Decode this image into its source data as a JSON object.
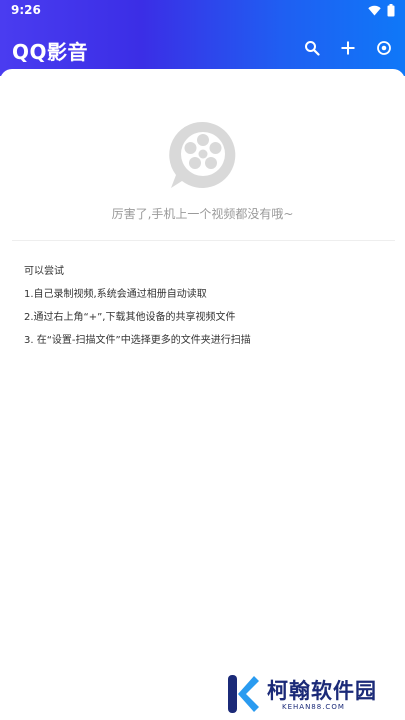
{
  "status_bar": {
    "time": "9:26",
    "icons": [
      "wifi-icon",
      "battery-icon"
    ]
  },
  "header": {
    "title": "QQ影音",
    "actions": [
      {
        "name": "search",
        "icon": "search-icon"
      },
      {
        "name": "add",
        "icon": "plus-icon"
      },
      {
        "name": "settings",
        "icon": "target-icon"
      }
    ]
  },
  "empty_state": {
    "icon": "film-reel-icon",
    "message": "厉害了,手机上一个视频都没有哦~"
  },
  "tips": {
    "title": "可以尝试",
    "items": [
      "1.自己录制视频,系统会通过相册自动读取",
      "2.通过右上角“+”,下载其他设备的共享视频文件",
      "3. 在“设置-扫描文件”中选择更多的文件夹进行扫描"
    ]
  },
  "watermark": {
    "brand": "柯翰软件园",
    "url": "KEHAN88.COM"
  },
  "colors": {
    "header_start": "#4a3cf0",
    "header_end": "#0f78f8",
    "empty_text": "#9a9a9a",
    "watermark": "#1b2a78"
  }
}
